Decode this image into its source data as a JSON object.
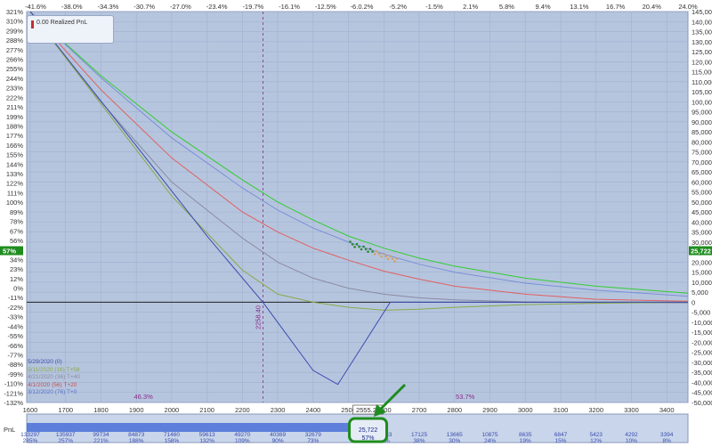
{
  "chart_data": {
    "type": "line",
    "x_ticks": [
      1600,
      1700,
      1800,
      1900,
      2000,
      2100,
      2200,
      2300,
      2400,
      2500,
      2600,
      2700,
      2800,
      2900,
      3000,
      3100,
      3200,
      3300,
      3400
    ],
    "xlim": [
      1590,
      3460
    ],
    "top_pct_ticks": [
      "-41.6%",
      "-38.0%",
      "-34.3%",
      "-30.7%",
      "-27.0%",
      "-23.4%",
      "-19.7%",
      "-16.1%",
      "-12.5%",
      "-8.8%",
      "-5.2%",
      "-1.5%",
      "2.1%",
      "5.8%",
      "9.4%",
      "13.1%",
      "16.7%",
      "20.4%",
      "24.0%"
    ],
    "top_highlight": "-6.0.2%",
    "left_ticks": [
      "321%",
      "310%",
      "299%",
      "288%",
      "277%",
      "266%",
      "255%",
      "244%",
      "233%",
      "222%",
      "211%",
      "199%",
      "188%",
      "177%",
      "166%",
      "155%",
      "144%",
      "133%",
      "122%",
      "111%",
      "100%",
      "89%",
      "78%",
      "67%",
      "56%",
      "45%",
      "34%",
      "23%",
      "12%",
      "0%",
      "-11%",
      "-22%",
      "-33%",
      "-44%",
      "-55%",
      "-66%",
      "-77%",
      "-88%",
      "-99%",
      "-110%",
      "-121%",
      "-132%"
    ],
    "right_ticks": [
      "145,000",
      "140,000",
      "135,000",
      "130,000",
      "125,000",
      "120,000",
      "115,000",
      "110,000",
      "105,000",
      "100,000",
      "95,000",
      "90,000",
      "85,000",
      "80,000",
      "75,000",
      "70,000",
      "65,000",
      "60,000",
      "55,000",
      "50,000",
      "45,000",
      "40,000",
      "35,000",
      "30,000",
      "25,000",
      "20,000",
      "15,000",
      "10,000",
      "5,000",
      "0",
      "-5,000",
      "-10,000",
      "-15,000",
      "-20,000",
      "-25,000",
      "-30,000",
      "-35,000",
      "-40,000",
      "-45,000",
      "-50,000"
    ],
    "ylim": [
      -50000,
      145000
    ],
    "current_pnl_label": "25,722",
    "current_pct_label": "57%",
    "current_price_label": "2555.27",
    "strike_label": "2258.40",
    "left_zone_pct": "46.3%",
    "right_zone_pct": "53.7%",
    "strike_x": 2258.4,
    "current_x": 2555.27,
    "series": [
      {
        "name": "5/29/2020 (0)",
        "color": "#3a4db0",
        "x": [
          1600,
          1900,
          2100,
          2258,
          2400,
          2470,
          2618,
          3460
        ],
        "y": [
          145000,
          78000,
          33000,
          0,
          -34000,
          -41000,
          0,
          0
        ]
      },
      {
        "name": "5/11/2020 (16) T+58",
        "color": "#8aa848",
        "x": [
          1600,
          1800,
          2000,
          2200,
          2300,
          2400,
          2500,
          2600,
          2700,
          2800,
          3000,
          3200,
          3460
        ],
        "y": [
          145000,
          99000,
          53000,
          16000,
          4000,
          0,
          -2500,
          -4000,
          -3500,
          -2500,
          -1200,
          -500,
          0
        ]
      },
      {
        "name": "4/21/2020 (36) T+40",
        "color": "#8a8aa0",
        "x": [
          1600,
          1800,
          2000,
          2200,
          2300,
          2400,
          2500,
          2600,
          2700,
          2800,
          3000,
          3200,
          3460
        ],
        "y": [
          145000,
          100000,
          60000,
          32000,
          20000,
          12000,
          7000,
          4000,
          2200,
          1200,
          200,
          -200,
          -300
        ]
      },
      {
        "name": "4/1/2020 (56) T+20",
        "color": "#e06060",
        "x": [
          1600,
          1800,
          2000,
          2200,
          2300,
          2400,
          2500,
          2600,
          2700,
          2800,
          3000,
          3200,
          3460
        ],
        "y": [
          145000,
          106000,
          72000,
          45000,
          35000,
          27000,
          21000,
          15500,
          11500,
          8000,
          4000,
          1500,
          500
        ]
      },
      {
        "name": "3/12/2020 (76) T+0",
        "color": "#7a90d8",
        "x": [
          1600,
          1800,
          2000,
          2200,
          2300,
          2400,
          2500,
          2600,
          2700,
          2800,
          3000,
          3200,
          3460
        ],
        "y": [
          145000,
          112000,
          82000,
          57000,
          46000,
          37000,
          30000,
          24000,
          19000,
          15000,
          9500,
          6000,
          3000
        ]
      }
    ],
    "green_curve": {
      "name": "",
      "color": "#33cc33",
      "x": [
        1600,
        1800,
        2000,
        2200,
        2300,
        2400,
        2500,
        2600,
        2700,
        2800,
        3000,
        3200,
        3460
      ],
      "y": [
        145000,
        113000,
        85000,
        61000,
        50000,
        41000,
        33000,
        27000,
        22000,
        18000,
        12000,
        8000,
        4500
      ]
    },
    "bottom_prices": [
      "133297",
      "135937",
      "99734",
      "84873",
      "71460",
      "59613",
      "49270",
      "40369",
      "32679",
      "",
      "23383",
      "17125",
      "13665",
      "10875",
      "8635",
      "6847",
      "5423",
      "4292",
      "3394"
    ],
    "bottom_pcts": [
      "285%",
      "257%",
      "221%",
      "188%",
      "158%",
      "132%",
      "109%",
      "90%",
      "73%",
      "",
      "47%",
      "38%",
      "30%",
      "24%",
      "19%",
      "15%",
      "12%",
      "10%",
      "8%"
    ],
    "bottom_highlight_top": "25,722",
    "bottom_highlight_bottom": "57%"
  },
  "legend_title": "0.00 Realized PnL",
  "legend_items": [
    {
      "label": "5/29/2020 (0)",
      "color": "#3a4db0"
    },
    {
      "label": "5/11/2020 (16) T+58",
      "color": "#8aa848"
    },
    {
      "label": "4/21/2020 (36) T+40",
      "color": "#8a8aa0"
    },
    {
      "label": "4/1/2020 (56) T+20",
      "color": "#c05050"
    },
    {
      "label": "3/12/2020 (76) T+0",
      "color": "#5a70c8"
    }
  ],
  "bottom_axis_label": "PnL",
  "colors": {
    "plot_bg": "#b6c5de",
    "grid": "#9fb1cf",
    "accent_green": "#1e8c1e"
  }
}
